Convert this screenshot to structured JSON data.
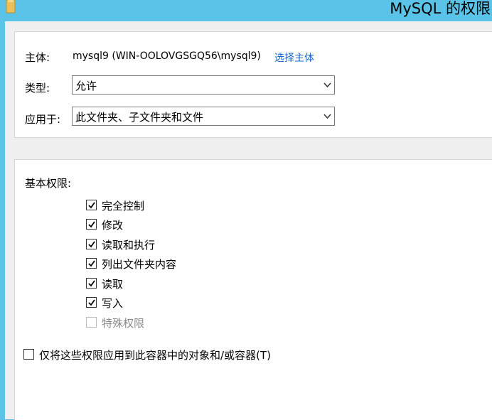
{
  "window": {
    "title": "MySQL 的权限",
    "folder_icon": "folder-icon"
  },
  "principal": {
    "label": "主体:",
    "value": "mysql9 (WIN-OOLOVGSGQ56\\mysql9)",
    "select_link": "选择主体"
  },
  "type": {
    "label": "类型:",
    "selected": "允许"
  },
  "applies_to": {
    "label": "应用于:",
    "selected": "此文件夹、子文件夹和文件"
  },
  "basic_permissions": {
    "heading": "基本权限:",
    "items": [
      {
        "label": "完全控制",
        "checked": true,
        "enabled": true
      },
      {
        "label": "修改",
        "checked": true,
        "enabled": true
      },
      {
        "label": "读取和执行",
        "checked": true,
        "enabled": true
      },
      {
        "label": "列出文件夹内容",
        "checked": true,
        "enabled": true
      },
      {
        "label": "读取",
        "checked": true,
        "enabled": true
      },
      {
        "label": "写入",
        "checked": true,
        "enabled": true
      },
      {
        "label": "特殊权限",
        "checked": false,
        "enabled": false
      }
    ]
  },
  "apply_only": {
    "label": "仅将这些权限应用到此容器中的对象和/或容器(T)",
    "checked": false
  }
}
